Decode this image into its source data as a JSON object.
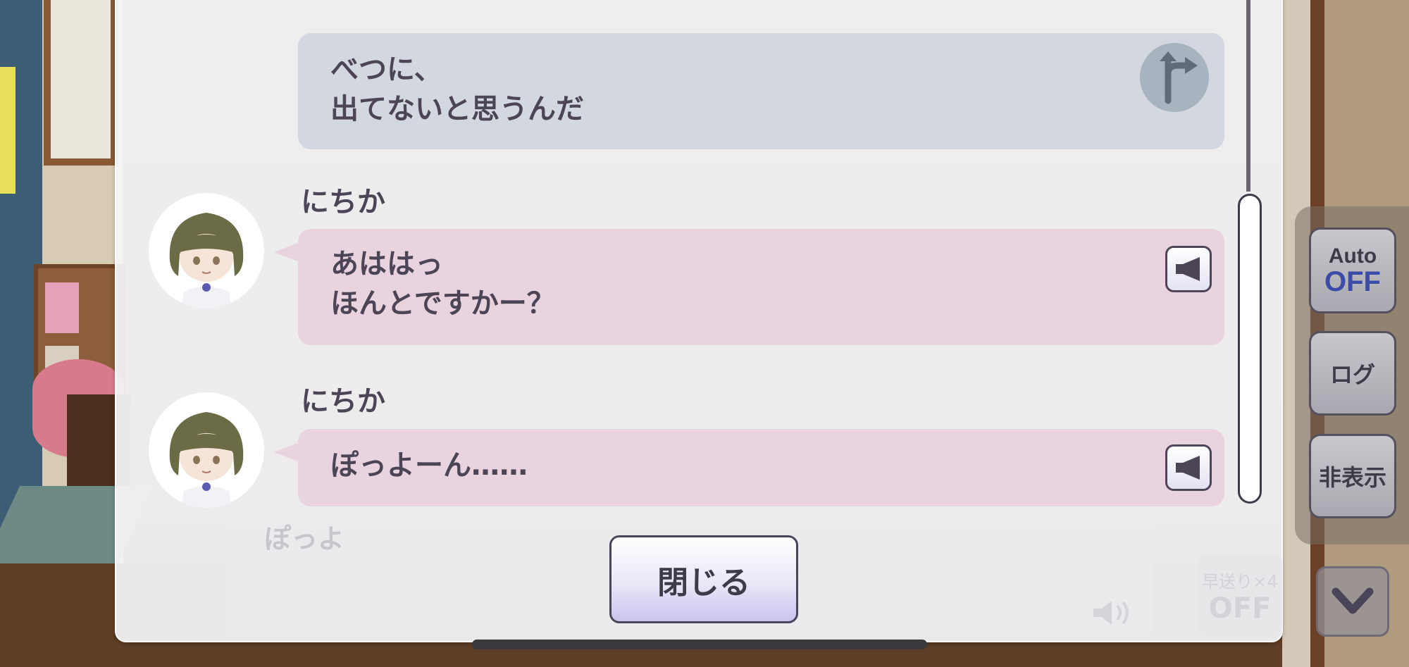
{
  "log": {
    "entries": [
      {
        "type": "choice",
        "lines": [
          "べつに、",
          "出てないと思うんだ"
        ],
        "icon": "branch-icon"
      },
      {
        "type": "dialogue",
        "speaker": "にちか",
        "lines": [
          "あははっ",
          "ほんとですかー？"
        ],
        "icon": "speaker-icon"
      },
      {
        "type": "dialogue",
        "speaker": "にちか",
        "lines": [
          "ぽっよーん……"
        ],
        "icon": "speaker-icon"
      }
    ],
    "close_label": "閉じる"
  },
  "background_dialogue": {
    "text": "ぽっよ",
    "fast_forward_label": "早送り×4",
    "fast_forward_state": "OFF"
  },
  "side_controls": {
    "auto_label": "Auto",
    "auto_state": "OFF",
    "log_label": "ログ",
    "hide_label": "非表示",
    "down_icon": "chevron-down-icon"
  },
  "colors": {
    "choice_bubble": "#d3d7df",
    "dialogue_bubble": "#e9d3de",
    "text": "#4c4556",
    "auto_off": "#3c4ba8"
  }
}
